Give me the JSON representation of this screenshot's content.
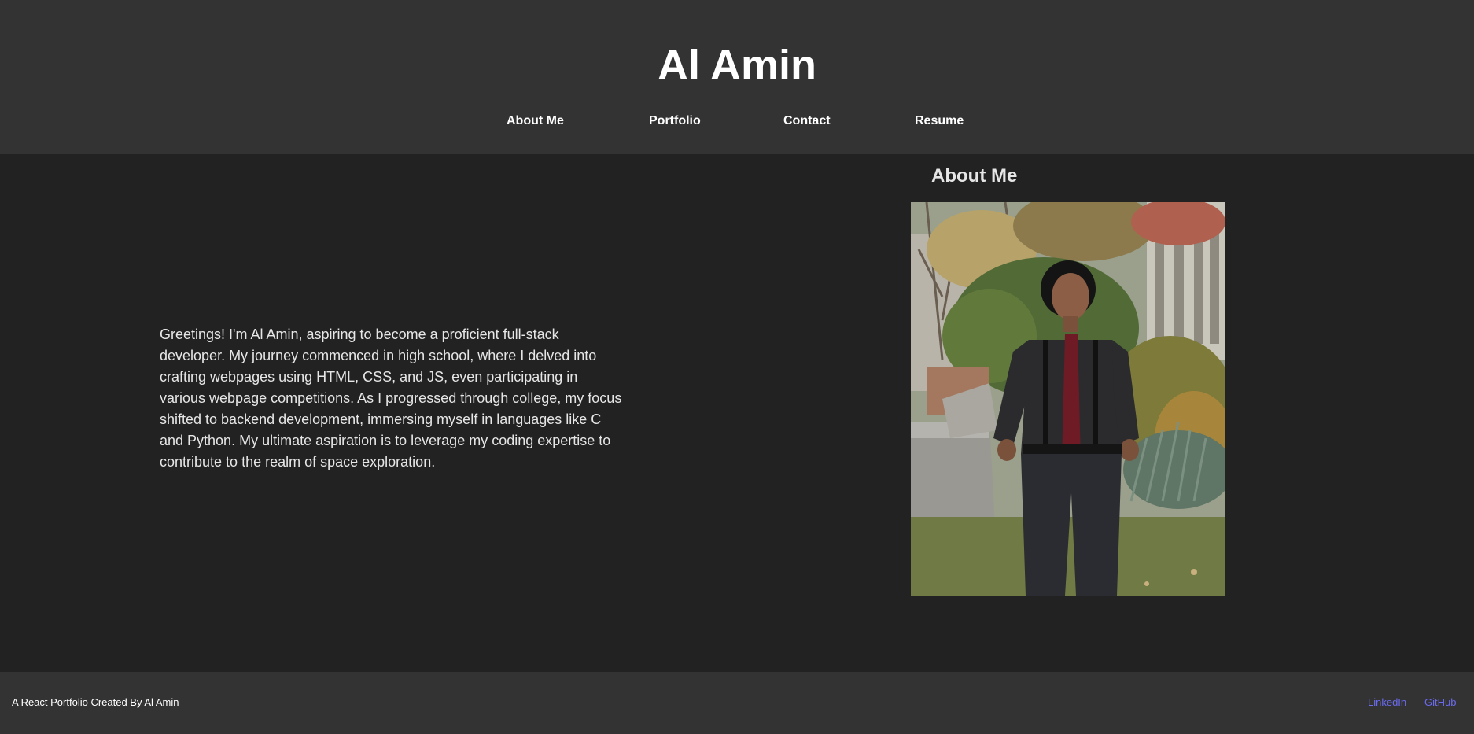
{
  "header": {
    "title": "Al Amin",
    "nav": [
      {
        "label": "About Me"
      },
      {
        "label": "Portfolio"
      },
      {
        "label": "Contact"
      },
      {
        "label": "Resume"
      }
    ]
  },
  "main": {
    "intro": "Greetings! I'm Al Amin, aspiring to become a proficient full-stack developer. My journey commenced in high school, where I delved into crafting webpages using HTML, CSS, and JS, even participating in various webpage competitions. As I progressed through college, my focus shifted to backend development, immersing myself in languages like C and Python. My ultimate aspiration is to leverage my coding expertise to contribute to the realm of space exploration.",
    "section_heading": "About Me"
  },
  "footer": {
    "credit": "A React Portfolio Created By Al Amin",
    "links": [
      {
        "label": "LinkedIn"
      },
      {
        "label": "GitHub"
      }
    ]
  },
  "colors": {
    "header_bg": "#333333",
    "page_bg": "#222222",
    "footer_bg": "#333333",
    "link": "#6b6bf0",
    "text": "#ffffff"
  }
}
